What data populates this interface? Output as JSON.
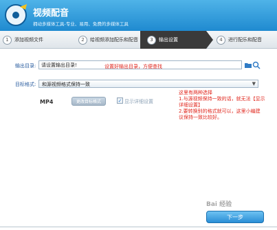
{
  "app": {
    "title": "视频配音",
    "subtitle": "拥动多媒体工具-专业、易用、免费的多媒体工具"
  },
  "steps": [
    {
      "num": "1",
      "label": "添加视频文件"
    },
    {
      "num": "2",
      "label": "给视频添加配乐和配音"
    },
    {
      "num": "3",
      "label": "输出设置"
    },
    {
      "num": "4",
      "label": "进行配乐和配音"
    }
  ],
  "output": {
    "label": "输出目录:",
    "value": "请设置输出目录!",
    "annotation": "设置好输出目录，方便查找"
  },
  "format": {
    "label": "目标格式:",
    "selected": "和源视频格式保持一致",
    "type": "MP4",
    "change_button": "更改目标格式",
    "show_details": "显示详细设置"
  },
  "annotation_block": [
    "这里有两种选择",
    "1.与源视频保持一致的话，就无法【显示",
    "详细设置】",
    "2.要转换别的格式就可以，这里小编建",
    "议保持一致比较好。"
  ],
  "watermark": "Bai 经验",
  "next_button": "下一步",
  "colors": {
    "header": "#1f8ad0",
    "active_step": "#3a3a3a",
    "annotation": "#e0261c"
  }
}
